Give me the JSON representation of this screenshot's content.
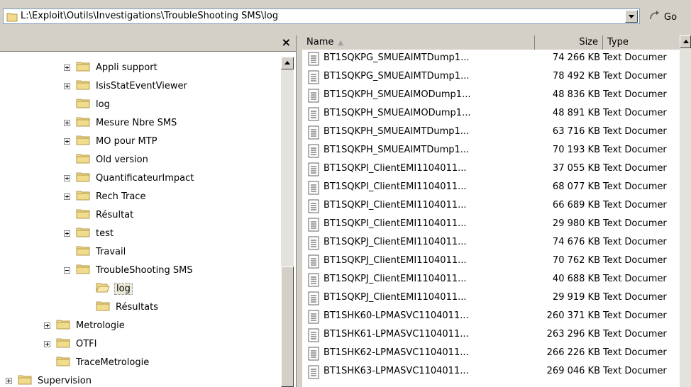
{
  "address": {
    "path": "L:\\Exploit\\Outils\\Investigations\\TroubleShooting SMS\\log",
    "go_label": "Go"
  },
  "tree": {
    "close_label": "×",
    "items": [
      {
        "label": "Appli support",
        "level": 3,
        "expander": "plus"
      },
      {
        "label": "IsisStatEventViewer",
        "level": 3,
        "expander": "plus"
      },
      {
        "label": "log",
        "level": 3,
        "expander": "none"
      },
      {
        "label": "Mesure Nbre SMS",
        "level": 3,
        "expander": "plus"
      },
      {
        "label": "MO pour MTP",
        "level": 3,
        "expander": "plus"
      },
      {
        "label": "Old version",
        "level": 3,
        "expander": "none"
      },
      {
        "label": "QuantificateurImpact",
        "level": 3,
        "expander": "plus"
      },
      {
        "label": "Rech Trace",
        "level": 3,
        "expander": "plus"
      },
      {
        "label": "Résultat",
        "level": 3,
        "expander": "none"
      },
      {
        "label": "test",
        "level": 3,
        "expander": "plus"
      },
      {
        "label": "Travail",
        "level": 3,
        "expander": "none"
      },
      {
        "label": "TroubleShooting SMS",
        "level": 3,
        "expander": "minus"
      },
      {
        "label": "log",
        "level": 4,
        "expander": "none",
        "selected": true,
        "open": true
      },
      {
        "label": "Résultats",
        "level": 4,
        "expander": "none"
      },
      {
        "label": "Metrologie",
        "level": 2,
        "expander": "plus"
      },
      {
        "label": "OTFI",
        "level": 2,
        "expander": "plus"
      },
      {
        "label": "TraceMetrologie",
        "level": 2,
        "expander": "none"
      },
      {
        "label": "Supervision",
        "level": 1,
        "expander": "plus"
      }
    ]
  },
  "list": {
    "columns": {
      "name": "Name",
      "size": "Size",
      "type": "Type"
    },
    "rows": [
      {
        "name": "BT1SQKPG_SMUEAIMTDump1...",
        "size": "74 266 KB",
        "type": "Text Documer"
      },
      {
        "name": "BT1SQKPG_SMUEAIMTDump1...",
        "size": "78 492 KB",
        "type": "Text Documer"
      },
      {
        "name": "BT1SQKPH_SMUEAIMODump1...",
        "size": "48 836 KB",
        "type": "Text Documer"
      },
      {
        "name": "BT1SQKPH_SMUEAIMODump1...",
        "size": "48 891 KB",
        "type": "Text Documer"
      },
      {
        "name": "BT1SQKPH_SMUEAIMTDump1...",
        "size": "63 716 KB",
        "type": "Text Documer"
      },
      {
        "name": "BT1SQKPH_SMUEAIMTDump1...",
        "size": "70 193 KB",
        "type": "Text Documer"
      },
      {
        "name": "BT1SQKPI_ClientEMI1104011...",
        "size": "37 055 KB",
        "type": "Text Documer"
      },
      {
        "name": "BT1SQKPI_ClientEMI1104011...",
        "size": "68 077 KB",
        "type": "Text Documer"
      },
      {
        "name": "BT1SQKPI_ClientEMI1104011...",
        "size": "66 689 KB",
        "type": "Text Documer"
      },
      {
        "name": "BT1SQKPI_ClientEMI1104011...",
        "size": "29 980 KB",
        "type": "Text Documer"
      },
      {
        "name": "BT1SQKPJ_ClientEMI1104011...",
        "size": "74 676 KB",
        "type": "Text Documer"
      },
      {
        "name": "BT1SQKPJ_ClientEMI1104011...",
        "size": "70 762 KB",
        "type": "Text Documer"
      },
      {
        "name": "BT1SQKPJ_ClientEMI1104011...",
        "size": "40 688 KB",
        "type": "Text Documer"
      },
      {
        "name": "BT1SQKPJ_ClientEMI1104011...",
        "size": "29 919 KB",
        "type": "Text Documer"
      },
      {
        "name": "BT1SHK60-LPMASVC1104011...",
        "size": "260 371 KB",
        "type": "Text Documer"
      },
      {
        "name": "BT1SHK61-LPMASVC1104011...",
        "size": "263 296 KB",
        "type": "Text Documer"
      },
      {
        "name": "BT1SHK62-LPMASVC1104011...",
        "size": "266 226 KB",
        "type": "Text Documer"
      },
      {
        "name": "BT1SHK63-LPMASVC1104011...",
        "size": "269 046 KB",
        "type": "Text Documer"
      }
    ]
  },
  "colors": {
    "folder": "#f1dc8e",
    "folder_dark": "#b49848",
    "selection_bg": "#ece9d8"
  }
}
